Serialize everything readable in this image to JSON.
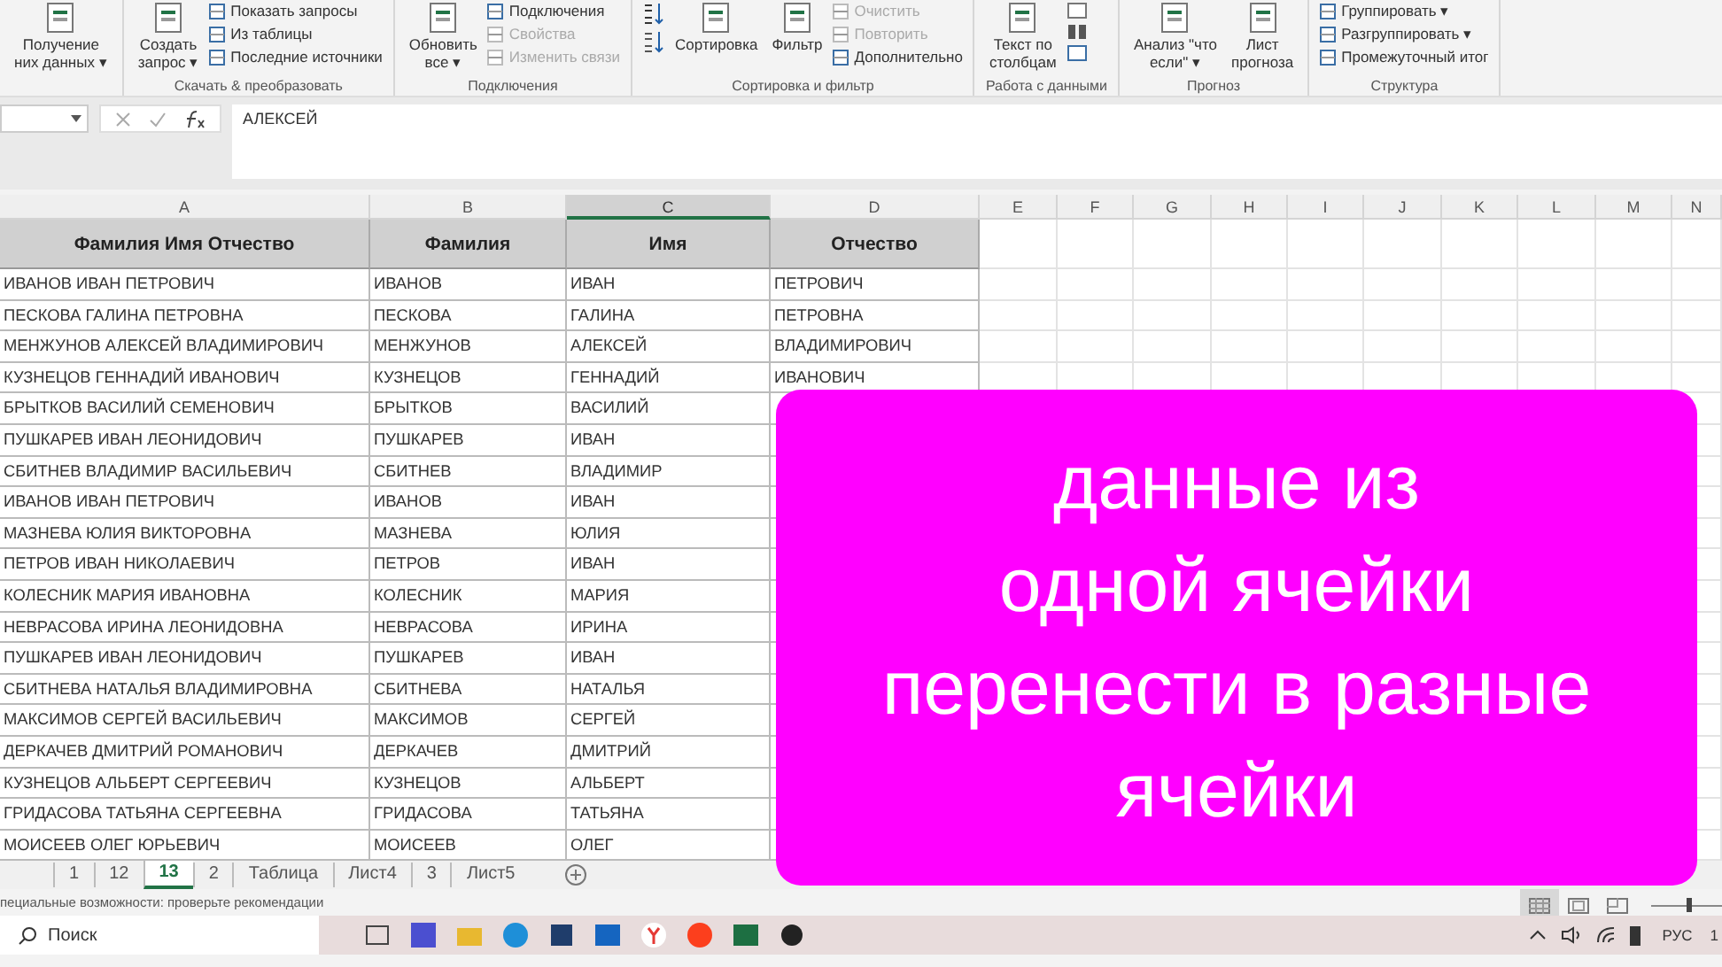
{
  "ribbon": {
    "groups": [
      {
        "items": [
          {
            "kind": "big",
            "label": "Получение\nних данных ▾",
            "disabled": false
          }
        ]
      },
      {
        "label": "Скачать & преобразовать",
        "items": [
          {
            "kind": "big",
            "label": "Создать\nзапрос ▾",
            "disabled": false
          },
          {
            "kind": "small",
            "label": "Показать запросы",
            "disabled": false
          },
          {
            "kind": "small",
            "label": "Из таблицы",
            "disabled": false
          },
          {
            "kind": "small",
            "label": "Последние источники",
            "disabled": false
          }
        ]
      },
      {
        "label": "Подключения",
        "items": [
          {
            "kind": "big",
            "label": "Обновить\nвсе ▾",
            "disabled": false
          },
          {
            "kind": "small",
            "label": "Подключения",
            "disabled": false
          },
          {
            "kind": "small",
            "label": "Свойства",
            "disabled": true
          },
          {
            "kind": "small",
            "label": "Изменить связи",
            "disabled": true
          }
        ]
      },
      {
        "label": "Сортировка и фильтр",
        "items": [
          {
            "kind": "sorticons"
          },
          {
            "kind": "big",
            "label": "Сортировка",
            "disabled": false
          },
          {
            "kind": "big",
            "label": "Фильтр",
            "disabled": false
          },
          {
            "kind": "small",
            "label": "Очистить",
            "disabled": true
          },
          {
            "kind": "small",
            "label": "Повторить",
            "disabled": true
          },
          {
            "kind": "small",
            "label": "Дополнительно",
            "disabled": false
          }
        ]
      },
      {
        "label": "Работа с данными",
        "items": [
          {
            "kind": "big",
            "label": "Текст по\nстолбцам",
            "disabled": false
          },
          {
            "kind": "tools"
          }
        ]
      },
      {
        "label": "Прогноз",
        "items": [
          {
            "kind": "big",
            "label": "Анализ \"что\nесли\" ▾",
            "disabled": false
          },
          {
            "kind": "big",
            "label": "Лист\nпрогноза",
            "disabled": false
          }
        ]
      },
      {
        "label": "Структура",
        "items": [
          {
            "kind": "small",
            "label": "Группировать ▾",
            "disabled": false
          },
          {
            "kind": "small",
            "label": "Разгруппировать ▾",
            "disabled": false
          },
          {
            "kind": "small",
            "label": "Промежуточный итог",
            "disabled": false
          }
        ]
      }
    ]
  },
  "formula_bar": {
    "value": "АЛЕКСЕЙ"
  },
  "columns": [
    {
      "letter": "A",
      "selected": false
    },
    {
      "letter": "B",
      "selected": false
    },
    {
      "letter": "C",
      "selected": true
    },
    {
      "letter": "D",
      "selected": false
    },
    {
      "letter": "E",
      "selected": false
    },
    {
      "letter": "F",
      "selected": false
    },
    {
      "letter": "G",
      "selected": false
    },
    {
      "letter": "H",
      "selected": false
    },
    {
      "letter": "I",
      "selected": false
    },
    {
      "letter": "J",
      "selected": false
    },
    {
      "letter": "K",
      "selected": false
    },
    {
      "letter": "L",
      "selected": false
    },
    {
      "letter": "M",
      "selected": false
    },
    {
      "letter": "N",
      "selected": false
    }
  ],
  "table": {
    "headers": [
      "Фамилия  Имя Отчество",
      "Фамилия",
      "Имя",
      "Отчество"
    ],
    "rows": [
      [
        "ИВАНОВ ИВАН ПЕТРОВИЧ",
        "ИВАНОВ",
        "ИВАН",
        "ПЕТРОВИЧ"
      ],
      [
        "ПЕСКОВА ГАЛИНА ПЕТРОВНА",
        "ПЕСКОВА",
        "ГАЛИНА",
        "ПЕТРОВНА"
      ],
      [
        "МЕНЖУНОВ АЛЕКСЕЙ ВЛАДИМИРОВИЧ",
        "МЕНЖУНОВ",
        "АЛЕКСЕЙ",
        "ВЛАДИМИРОВИЧ"
      ],
      [
        "КУЗНЕЦОВ ГЕННАДИЙ ИВАНОВИЧ",
        "КУЗНЕЦОВ",
        "ГЕННАДИЙ",
        "ИВАНОВИЧ"
      ],
      [
        "БРЫТКОВ ВАСИЛИЙ СЕМЕНОВИЧ",
        "БРЫТКОВ",
        "ВАСИЛИЙ"
      ],
      [
        "ПУШКАРЕВ ИВАН ЛЕОНИДОВИЧ",
        "ПУШКАРЕВ",
        "ИВАН"
      ],
      [
        "СБИТНЕВ ВЛАДИМИР ВАСИЛЬЕВИЧ",
        "СБИТНЕВ",
        "ВЛАДИМИР"
      ],
      [
        "ИВАНОВ ИВАН ПЕТРОВИЧ",
        "ИВАНОВ",
        "ИВАН"
      ],
      [
        "МАЗНЕВА ЮЛИЯ ВИКТОРОВНА",
        "МАЗНЕВА",
        "ЮЛИЯ"
      ],
      [
        "ПЕТРОВ ИВАН НИКОЛАЕВИЧ",
        "ПЕТРОВ",
        "ИВАН"
      ],
      [
        "КОЛЕСНИК МАРИЯ ИВАНОВНА",
        "КОЛЕСНИК",
        "МАРИЯ"
      ],
      [
        "НЕВРАСОВА ИРИНА ЛЕОНИДОВНА",
        "НЕВРАСОВА",
        "ИРИНА"
      ],
      [
        "ПУШКАРЕВ ИВАН ЛЕОНИДОВИЧ",
        "ПУШКАРЕВ",
        "ИВАН"
      ],
      [
        "СБИТНЕВА НАТАЛЬЯ ВЛАДИМИРОВНА",
        "СБИТНЕВА",
        "НАТАЛЬЯ"
      ],
      [
        "МАКСИМОВ СЕРГЕЙ ВАСИЛЬЕВИЧ",
        "МАКСИМОВ",
        "СЕРГЕЙ"
      ],
      [
        "ДЕРКАЧЕВ ДМИТРИЙ РОМАНОВИЧ",
        "ДЕРКАЧЕВ",
        "ДМИТРИЙ"
      ],
      [
        "КУЗНЕЦОВ АЛЬБЕРТ СЕРГЕЕВИЧ",
        "КУЗНЕЦОВ",
        "АЛЬБЕРТ"
      ],
      [
        "ГРИДАСОВА ТАТЬЯНА СЕРГЕЕВНА",
        "ГРИДАСОВА",
        "ТАТЬЯНА"
      ],
      [
        "МОИСЕЕВ ОЛЕГ ЮРЬЕВИЧ",
        "МОИСЕЕВ",
        "ОЛЕГ"
      ]
    ]
  },
  "overlay": {
    "text": "данные из\nодной ячейки\nперенести в разные\nячейки"
  },
  "sheet_tabs": [
    {
      "label": "1",
      "selected": false
    },
    {
      "label": "12",
      "selected": false
    },
    {
      "label": "13",
      "selected": true
    },
    {
      "label": "2",
      "selected": false
    },
    {
      "label": "Таблица",
      "selected": false
    },
    {
      "label": "Лист4",
      "selected": false
    },
    {
      "label": "3",
      "selected": false
    },
    {
      "label": "Лист5",
      "selected": false
    }
  ],
  "status_bar": {
    "text": "пециальные возможности: проверьте рекомендации",
    "views": [
      {
        "kind": "normal",
        "selected": true
      },
      {
        "kind": "layout",
        "selected": false
      },
      {
        "kind": "pagebreak",
        "selected": false
      }
    ],
    "zoom": {
      "level": 0.55
    }
  },
  "taskbar": {
    "search_placeholder": "Поиск",
    "language": "РУС",
    "clock": "1"
  }
}
